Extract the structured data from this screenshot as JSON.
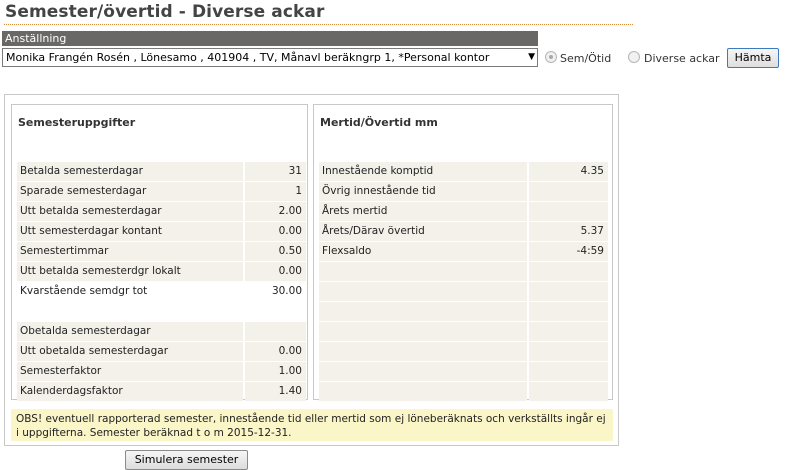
{
  "page": {
    "title": "Semester/övertid - Diverse ackar"
  },
  "employment": {
    "header": "Anställning",
    "selected": "Monika Frangén Rosén , Lönesamo , 401904 , TV, Månavl beräkngrp 1, *Personal kontor"
  },
  "options": {
    "sem_label": "Sem/Ötid",
    "diverse_label": "Diverse ackar",
    "fetch_label": "Hämta"
  },
  "left": {
    "title": "Semesteruppgifter",
    "rows": [
      {
        "label": "Betalda semesterdagar",
        "value": "31"
      },
      {
        "label": "Sparade semesterdagar",
        "value": "1"
      },
      {
        "label": "Utt betalda semesterdagar",
        "value": "2.00"
      },
      {
        "label": "Utt semesterdagar kontant",
        "value": "0.00"
      },
      {
        "label": "Semestertimmar",
        "value": "0.50"
      },
      {
        "label": "Utt betalda semesterdgr lokalt",
        "value": "0.00"
      },
      {
        "label": "Kvarstående semdgr tot",
        "value": "30.00"
      },
      {
        "label": "",
        "value": ""
      },
      {
        "label": "Obetalda semesterdagar",
        "value": ""
      },
      {
        "label": "Utt obetalda semesterdagar",
        "value": "0.00"
      },
      {
        "label": "Semesterfaktor",
        "value": "1.00"
      },
      {
        "label": "Kalenderdagsfaktor",
        "value": "1.40"
      }
    ]
  },
  "right": {
    "title": "Mertid/Övertid mm",
    "rows": [
      {
        "label": "Innestående komptid",
        "value": "4.35"
      },
      {
        "label": "Övrig innestående tid",
        "value": ""
      },
      {
        "label": "Årets mertid",
        "value": ""
      },
      {
        "label": "Årets/Därav övertid",
        "value": "5.37"
      },
      {
        "label": "Flexsaldo",
        "value": "-4:59"
      },
      {
        "label": "",
        "value": ""
      },
      {
        "label": "",
        "value": ""
      },
      {
        "label": "",
        "value": ""
      },
      {
        "label": "",
        "value": ""
      },
      {
        "label": "",
        "value": ""
      },
      {
        "label": "",
        "value": ""
      },
      {
        "label": "",
        "value": ""
      }
    ]
  },
  "note": "OBS! eventuell rapporterad semester, innestående tid eller mertid som ej löneberäknats och verkställts ingår ej i uppgifterna. Semester beräknad t o m 2015-12-31.",
  "simulate_label": "Simulera semester"
}
